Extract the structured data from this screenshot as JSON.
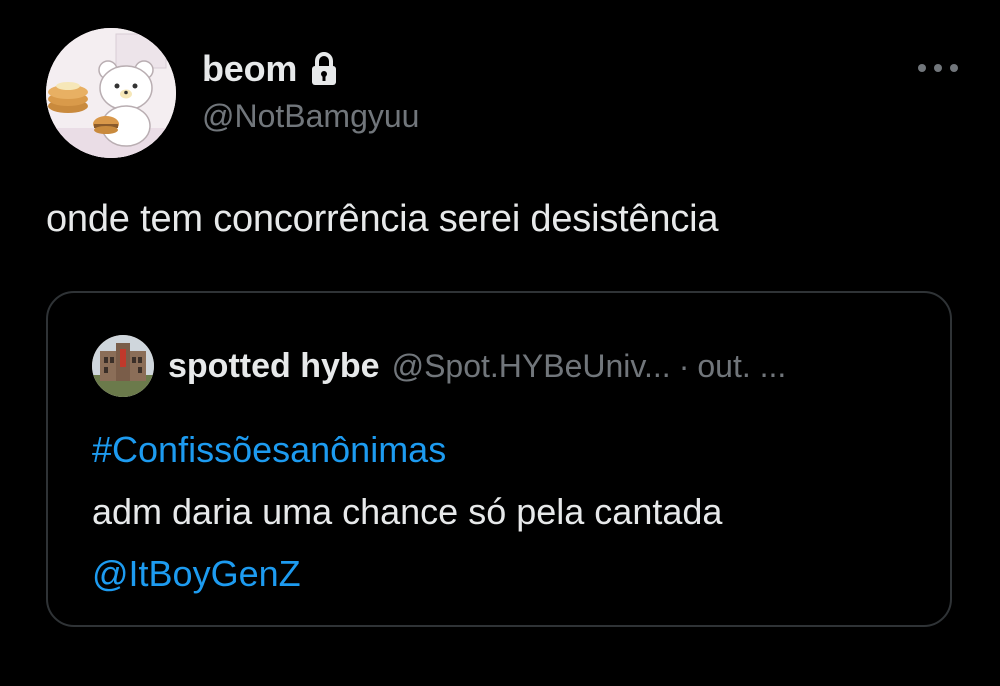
{
  "tweet": {
    "display_name": "beom",
    "handle": "@NotBamgyuu",
    "text": "onde tem concorrência serei desistência",
    "locked_icon": "lock-icon",
    "avatar_icon": "bear-avatar"
  },
  "quote": {
    "display_name": "spotted hybe",
    "handle": "@Spot.HYBeUniv...",
    "separator": "·",
    "date": "out. ...",
    "hashtag": "#Confissõesanônimas",
    "text": "adm daria uma chance só pela cantada",
    "mention": "@ItBoyGenZ",
    "avatar_icon": "building-avatar"
  },
  "colors": {
    "background": "#000000",
    "text": "#e7e9ea",
    "secondary": "#71767b",
    "link": "#1d9bf0",
    "border": "#2f3336"
  }
}
